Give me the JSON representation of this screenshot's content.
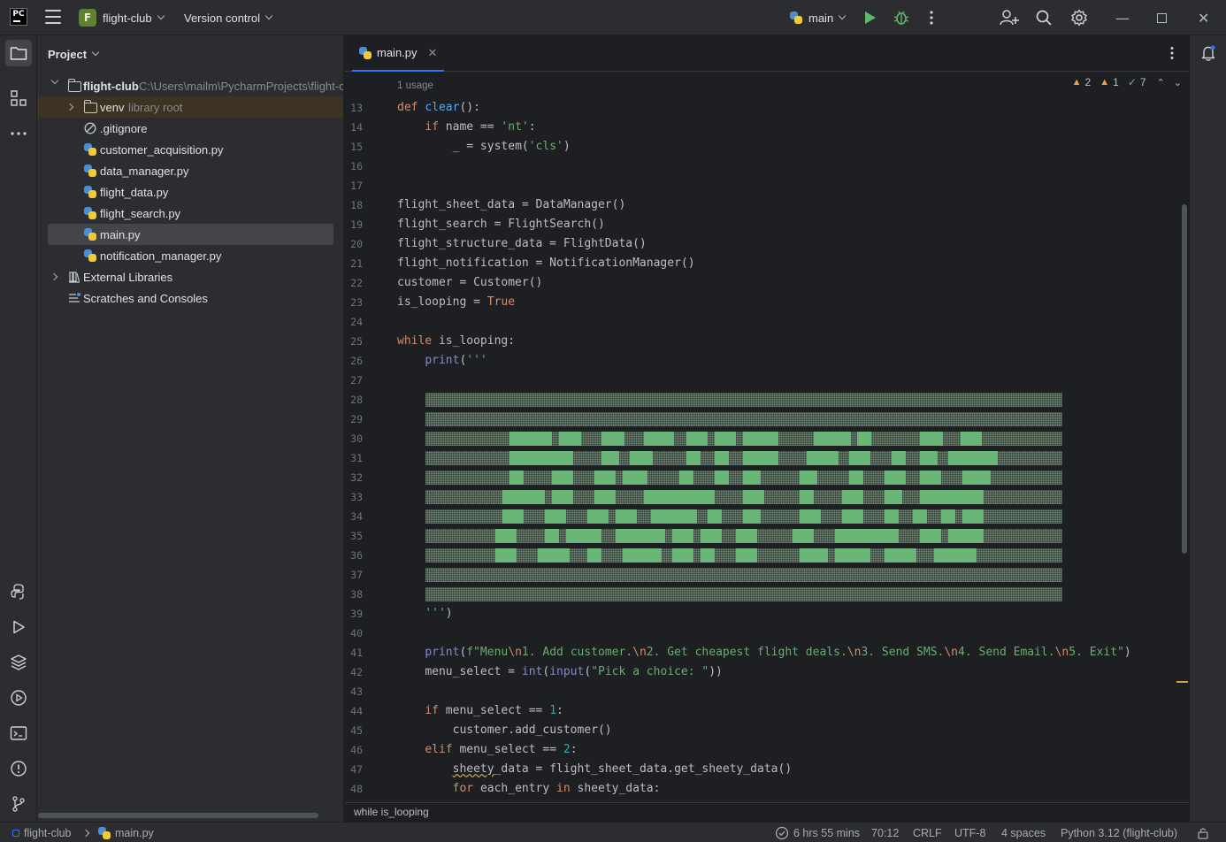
{
  "titlebar": {
    "app_logo": "PC",
    "project_badge": "F",
    "project_name": "flight-club",
    "vcs_label": "Version control",
    "run_config": "main"
  },
  "project_panel": {
    "header": "Project",
    "tree": [
      {
        "label": "flight-club",
        "detail": "C:\\Users\\mailm\\PycharmProjects\\flight-club",
        "icon": "folder-icon",
        "expanded": true
      },
      {
        "label": "venv",
        "detail": "library root",
        "icon": "folder-icon"
      },
      {
        "label": ".gitignore",
        "icon": "ignore-file-icon"
      },
      {
        "label": "customer_acquisition.py",
        "icon": "python-file-icon"
      },
      {
        "label": "data_manager.py",
        "icon": "python-file-icon"
      },
      {
        "label": "flight_data.py",
        "icon": "python-file-icon"
      },
      {
        "label": "flight_search.py",
        "icon": "python-file-icon"
      },
      {
        "label": "main.py",
        "icon": "python-file-icon",
        "selected": true
      },
      {
        "label": "notification_manager.py",
        "icon": "python-file-icon"
      },
      {
        "label": "External Libraries",
        "icon": "library-icon"
      },
      {
        "label": "Scratches and Consoles",
        "icon": "scratches-icon"
      }
    ]
  },
  "editor": {
    "tab_label": "main.py",
    "usage_hint": "1 usage",
    "inspections": {
      "warnings": "2",
      "weak_warnings": "1",
      "ok": "7"
    },
    "line_numbers": [
      "13",
      "14",
      "15",
      "16",
      "17",
      "18",
      "19",
      "20",
      "21",
      "22",
      "23",
      "24",
      "25",
      "26",
      "27",
      "28",
      "29",
      "30",
      "31",
      "32",
      "33",
      "34",
      "35",
      "36",
      "37",
      "38",
      "39",
      "40",
      "41",
      "42",
      "43",
      "44",
      "45",
      "46",
      "47",
      "48"
    ],
    "code": {
      "l13_kw": "def ",
      "l13_fn": "clear",
      "l13_rest": "():",
      "l14_kw": "if ",
      "l14_a": "name == ",
      "l14_str": "'nt'",
      "l14_b": ":",
      "l15_a": "_ = system(",
      "l15_str": "'cls'",
      "l15_b": ")",
      "l18": "flight_sheet_data = DataManager()",
      "l19": "flight_search = FlightSearch()",
      "l20": "flight_structure_data = FlightData()",
      "l21": "flight_notification = NotificationManager()",
      "l22": "customer = Customer()",
      "l23_a": "is_looping = ",
      "l23_kw": "True",
      "l25_kw": "while ",
      "l25_a": "is_looping:",
      "l26_bi": "print",
      "l26_a": "(",
      "l26_str": "'''",
      "l39_str": "'''",
      "l39_a": ")",
      "l41_bi": "print",
      "l41_a": "(",
      "l41_s1": "f\"Menu",
      "l41_e1": "\\n",
      "l41_s2": "1. Add customer.",
      "l41_e2": "\\n",
      "l41_s3": "2. Get cheapest flight deals.",
      "l41_e3": "\\n",
      "l41_s4": "3. Send SMS.",
      "l41_e4": "\\n",
      "l41_s5": "4. Send Email.",
      "l41_e5": "\\n",
      "l41_s6": "5. Exit\"",
      "l41_b": ")",
      "l42_a": "menu_select = ",
      "l42_bi1": "int",
      "l42_b": "(",
      "l42_bi2": "input",
      "l42_c": "(",
      "l42_str": "\"Pick a choice: \"",
      "l42_d": "))",
      "l44_kw": "if ",
      "l44_a": "menu_select == ",
      "l44_num": "1",
      "l44_b": ":",
      "l45": "customer.add_customer()",
      "l46_kw": "elif ",
      "l46_a": "menu_select == ",
      "l46_num": "2",
      "l46_b": ":",
      "l47_u": "sheety",
      "l47_a": "_data = flight_sheet_data.get_sheety_data()",
      "l48_kw1": "for ",
      "l48_a": "each_entry ",
      "l48_kw2": "in ",
      "l48_b": "sheety_data:"
    },
    "breadcrumb": "while is_looping"
  },
  "statusbar": {
    "project": "flight-club",
    "file": "main.py",
    "time_tracked": "6 hrs 55 mins",
    "position": "70:12",
    "line_sep": "CRLF",
    "encoding": "UTF-8",
    "indent": "4 spaces",
    "interpreter": "Python 3.12 (flight-club)"
  },
  "colors": {
    "accent": "#3574f0",
    "run_green": "#5fb865",
    "ascii_green": "#6fc47f",
    "warning": "#e8a33c"
  }
}
